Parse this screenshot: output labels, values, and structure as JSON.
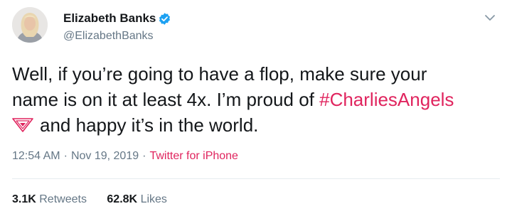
{
  "author": {
    "display_name": "Elizabeth Banks",
    "handle": "@ElizabethBanks",
    "verified": true,
    "avatar_icon": "profile-photo"
  },
  "tweet": {
    "line1": "Well, if you’re going to have a flop, make sure your",
    "line2_text": "name is on it at least 4x. I’m proud of ",
    "hashtag": "#CharliesAngels",
    "hashflag_icon": "charlies-angels-hashflag",
    "line3_text": "and happy it’s in the world."
  },
  "meta": {
    "time": "12:54 AM",
    "date": "Nov 19, 2019",
    "separator": "·",
    "source": "Twitter for iPhone"
  },
  "stats": {
    "retweets_count": "3.1K",
    "retweets_label": "Retweets",
    "likes_count": "62.8K",
    "likes_label": "Likes"
  },
  "colors": {
    "hashtag_accent": "#e0245e",
    "verified_badge": "#1da1f2",
    "secondary_text": "#657786",
    "primary_text": "#14171a"
  }
}
